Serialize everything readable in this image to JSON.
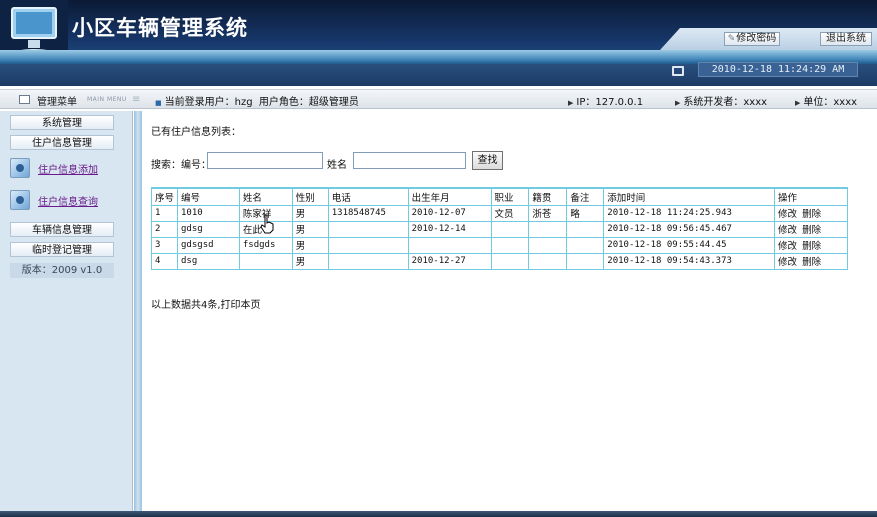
{
  "app": {
    "title": "小区车辆管理系统"
  },
  "header": {
    "change_password_label": "修改密码",
    "logout_label": "退出系统",
    "datetime": "2010-12-18 11:24:29 AM"
  },
  "infobar": {
    "menu_title": "管理菜单",
    "menu_subtitle": "MAIN MENU",
    "current_user_label": "当前登录用户：",
    "current_user": "hzg",
    "role_label": "用户角色：",
    "role": "超级管理员",
    "ip": "IP：127.0.0.1",
    "developer": "系统开发者：xxxx",
    "unit": "单位：xxxx"
  },
  "sidebar": {
    "groups": [
      {
        "label": "系统管理"
      },
      {
        "label": "住户信息管理"
      },
      {
        "label": "车辆信息管理"
      },
      {
        "label": "临时登记管理"
      }
    ],
    "subitems": [
      {
        "label": "住户信息添加",
        "icon": "user-add-icon"
      },
      {
        "label": "住户信息查询",
        "icon": "gear-search-icon"
      }
    ],
    "version": "版本：2009 v1.0"
  },
  "main": {
    "list_title": "已有住户信息列表：",
    "search": {
      "id_label": "搜索：编号：",
      "id_value": "",
      "name_label": "姓名",
      "name_value": "",
      "button_label": "查找"
    },
    "table": {
      "headers": [
        "序号",
        "编号",
        "姓名",
        "性别",
        "电话",
        "出生年月",
        "职业",
        "籍贯",
        "备注",
        "添加时间",
        "操作"
      ],
      "rows": [
        {
          "seq": "1",
          "id": "1010",
          "name": "陈家祥",
          "gender": "男",
          "phone": "1318548745",
          "birth": "2010-12-07",
          "job": "文员",
          "origin": "浙苍",
          "note": "略",
          "added": "2010-12-18 11:24:25.943"
        },
        {
          "seq": "2",
          "id": "gdsg",
          "name": "在此",
          "gender": "男",
          "phone": "",
          "birth": "2010-12-14",
          "job": "",
          "origin": "",
          "note": "",
          "added": "2010-12-18 09:56:45.467"
        },
        {
          "seq": "3",
          "id": "gdsgsd",
          "name": "fsdgds",
          "gender": "男",
          "phone": "",
          "birth": "",
          "job": "",
          "origin": "",
          "note": "",
          "added": "2010-12-18 09:55:44.45"
        },
        {
          "seq": "4",
          "id": "dsg",
          "name": "",
          "gender": "男",
          "phone": "",
          "birth": "2010-12-27",
          "job": "",
          "origin": "",
          "note": "",
          "added": "2010-12-18 09:54:43.373"
        }
      ],
      "edit_label": "修改",
      "delete_label": "删除"
    },
    "summary": "以上数据共4条,打印本页"
  }
}
